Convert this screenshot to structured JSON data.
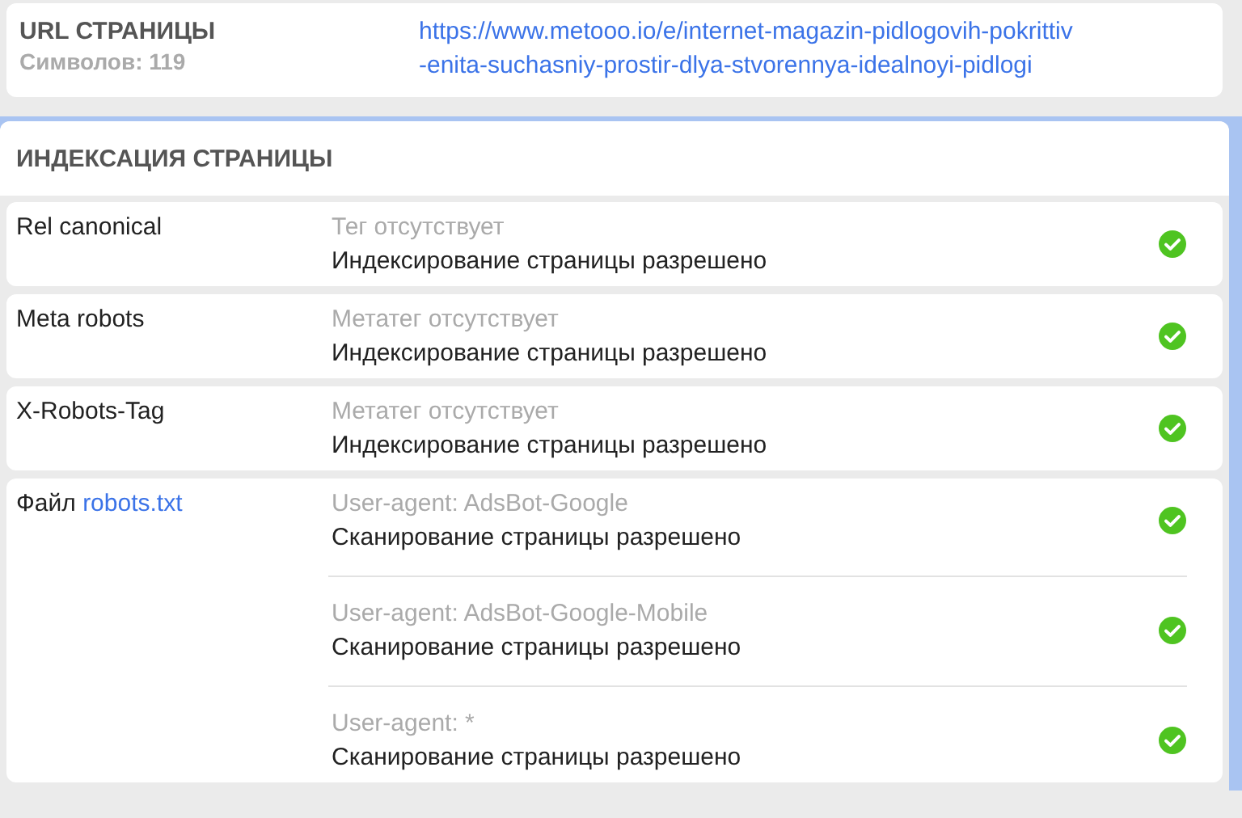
{
  "url_card": {
    "title": "URL СТРАНИЦЫ",
    "char_count": "Символов: 119",
    "url_lines": [
      "https://www.metooo.io/e/internet-magazin-pidlogovih-pokrittiv",
      "-enita-suchasniy-prostir-dlya-stvorennya-idealnoyi-pidlogi"
    ]
  },
  "indexing": {
    "title": "ИНДЕКСАЦИЯ СТРАНИЦЫ",
    "rows": [
      {
        "label": "Rel canonical",
        "entries": [
          {
            "note": "Тег отсутствует",
            "result": "Индексирование страницы разрешено",
            "passed": true
          }
        ]
      },
      {
        "label": "Meta robots",
        "entries": [
          {
            "note": "Метатег отсутствует",
            "result": "Индексирование страницы разрешено",
            "passed": true
          }
        ]
      },
      {
        "label": "X-Robots-Tag",
        "entries": [
          {
            "note": "Метатег отсутствует",
            "result": "Индексирование страницы разрешено",
            "passed": true
          }
        ]
      },
      {
        "label": "Файл",
        "link": "robots.txt",
        "entries": [
          {
            "note": "User-agent: AdsBot-Google",
            "result": "Сканирование страницы разрешено",
            "passed": true
          },
          {
            "note": "User-agent: AdsBot-Google-Mobile",
            "result": "Сканирование страницы разрешено",
            "passed": true
          },
          {
            "note": "User-agent: *",
            "result": "Сканирование страницы разрешено",
            "passed": true
          }
        ]
      }
    ]
  }
}
